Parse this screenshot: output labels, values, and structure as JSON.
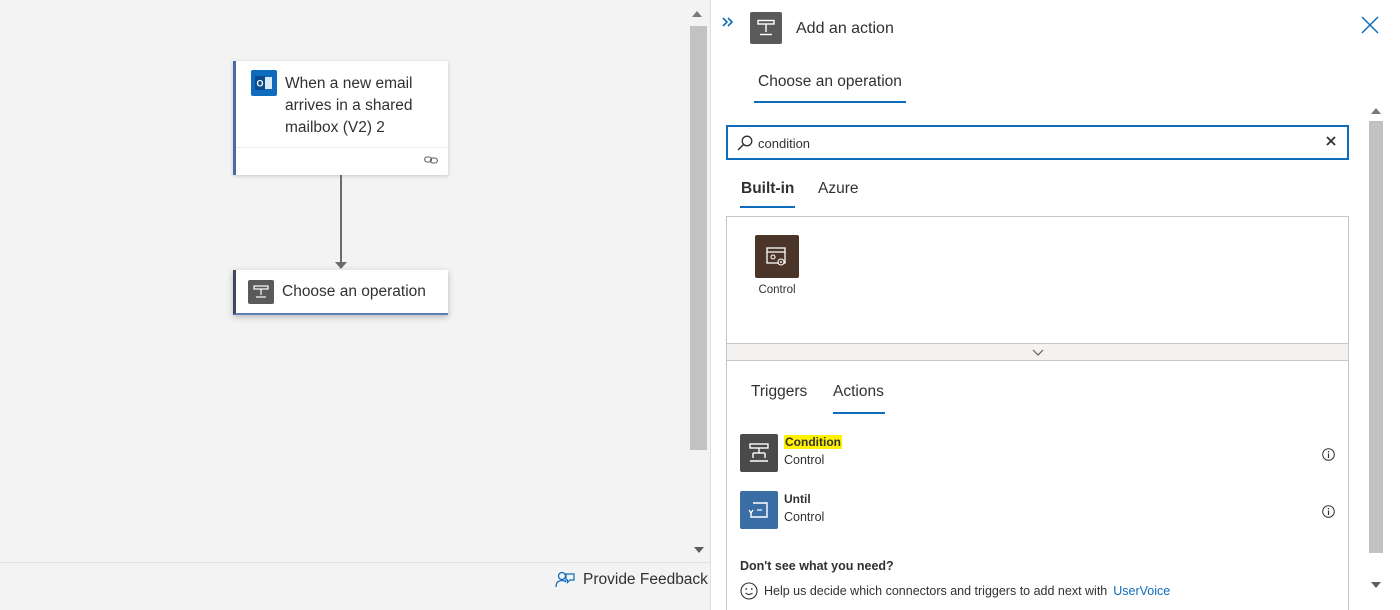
{
  "canvas": {
    "trigger_card": {
      "title": "When a new email arrives in a shared mailbox (V2) 2"
    },
    "operation_card": {
      "title": "Choose an operation"
    },
    "feedback_label": "Provide Feedback"
  },
  "panel": {
    "title": "Add an action",
    "tab": "Choose an operation",
    "search": {
      "value": "condition"
    },
    "connector_tabs": [
      "Built-in",
      "Azure"
    ],
    "connectors": [
      {
        "label": "Control"
      }
    ],
    "operation_tabs": [
      "Triggers",
      "Actions"
    ],
    "actions": [
      {
        "name": "Condition",
        "subtitle": "Control"
      },
      {
        "name": "Until",
        "subtitle": "Control"
      }
    ],
    "dont_see": "Don't see what you need?",
    "help_text": "Help us decide which connectors and triggers to add next with",
    "help_link": "UserVoice"
  },
  "colors": {
    "accent": "#0f6cbd",
    "control_tile": "#4b3528",
    "condition_tile": "#4a4a4a",
    "until_tile": "#3b6ea5",
    "highlight": "#fff200"
  }
}
